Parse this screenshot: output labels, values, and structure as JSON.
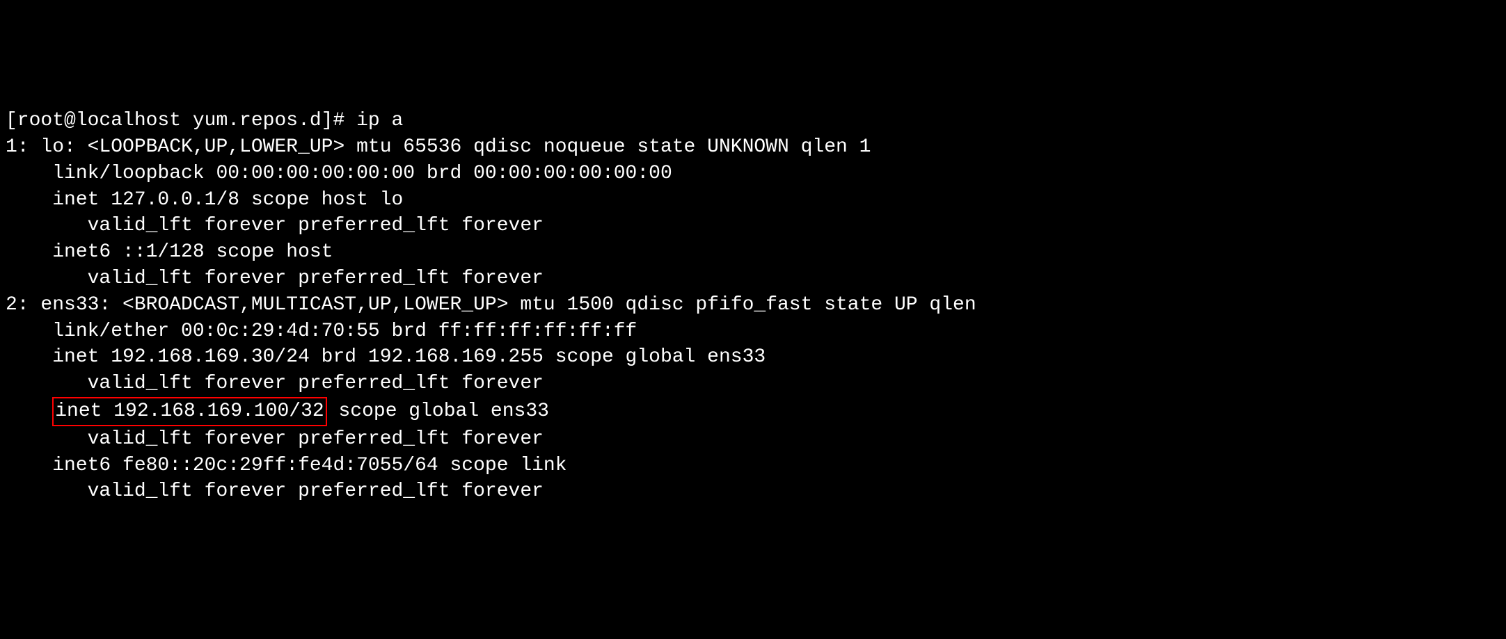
{
  "prompt": {
    "text": "[root@localhost yum.repos.d]# ",
    "command": "ip a"
  },
  "interfaces": {
    "lo": {
      "header": "1: lo: <LOOPBACK,UP,LOWER_UP> mtu 65536 qdisc noqueue state UNKNOWN qlen 1",
      "link": "    link/loopback 00:00:00:00:00:00 brd 00:00:00:00:00:00",
      "inet": "    inet 127.0.0.1/8 scope host lo",
      "inet_valid": "       valid_lft forever preferred_lft forever",
      "inet6": "    inet6 ::1/128 scope host",
      "inet6_valid": "       valid_lft forever preferred_lft forever"
    },
    "ens33": {
      "header": "2: ens33: <BROADCAST,MULTICAST,UP,LOWER_UP> mtu 1500 qdisc pfifo_fast state UP qlen",
      "link": "    link/ether 00:0c:29:4d:70:55 brd ff:ff:ff:ff:ff:ff",
      "inet1": "    inet 192.168.169.30/24 brd 192.168.169.255 scope global ens33",
      "inet1_valid": "       valid_lft forever preferred_lft forever",
      "inet2_prefix": "    ",
      "inet2_highlighted": "inet 192.168.169.100/32",
      "inet2_suffix": " scope global ens33",
      "inet2_valid": "       valid_lft forever preferred_lft forever",
      "inet6": "    inet6 fe80::20c:29ff:fe4d:7055/64 scope link",
      "inet6_valid": "       valid_lft forever preferred_lft forever"
    }
  }
}
